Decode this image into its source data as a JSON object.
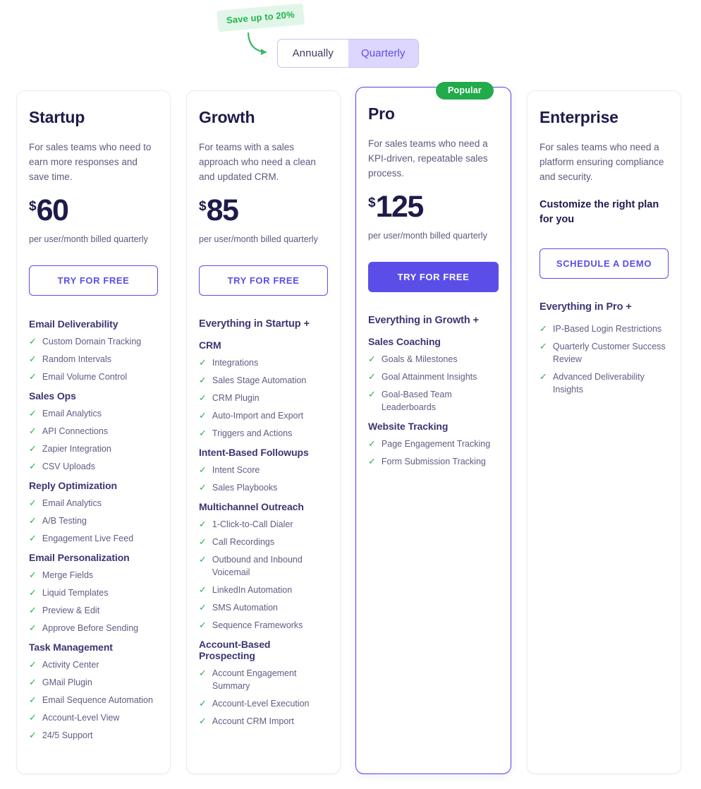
{
  "billing": {
    "save_badge": "Save up to 20%",
    "options": [
      {
        "label": "Annually",
        "active": false
      },
      {
        "label": "Quarterly",
        "active": true
      }
    ]
  },
  "badges": {
    "popular": "Popular"
  },
  "colors": {
    "accent": "#5b4ee8",
    "pro_border": "#4f46e5",
    "green": "#22b24c",
    "badge_green_bg": "#e1f6e8",
    "price": "#1e1b4b",
    "toggle_active_bg": "#ddd6fe"
  },
  "plans": [
    {
      "name": "Startup",
      "desc": "For sales teams who need to earn more responses and save time.",
      "currency": "$",
      "price": "60",
      "price_sub": "per user/month billed quarterly",
      "cta": "TRY FOR FREE",
      "cta_style": "outline",
      "groups": [
        {
          "heading": "Email Deliverability",
          "items": [
            "Custom Domain Tracking",
            "Random Intervals",
            "Email Volume Control"
          ]
        },
        {
          "heading": "Sales Ops",
          "items": [
            "Email Analytics",
            "API Connections",
            "Zapier Integration",
            "CSV Uploads"
          ]
        },
        {
          "heading": "Reply Optimization",
          "items": [
            "Email Analytics",
            "A/B Testing",
            "Engagement Live Feed"
          ]
        },
        {
          "heading": "Email Personalization",
          "items": [
            "Merge Fields",
            "Liquid Templates",
            "Preview & Edit",
            "Approve Before Sending"
          ]
        },
        {
          "heading": "Task Management",
          "items": [
            "Activity Center",
            "GMail Plugin",
            "Email Sequence Automation",
            "Account-Level View",
            "24/5 Support"
          ]
        }
      ]
    },
    {
      "name": "Growth",
      "desc": "For teams with a sales approach who need a clean and updated CRM.",
      "currency": "$",
      "price": "85",
      "price_sub": "per user/month billed quarterly",
      "cta": "TRY FOR FREE",
      "cta_style": "outline",
      "inherit": "Everything in Startup +",
      "groups": [
        {
          "heading": "CRM",
          "items": [
            "Integrations",
            "Sales Stage Automation",
            "CRM Plugin",
            "Auto-Import and Export",
            "Triggers and Actions"
          ]
        },
        {
          "heading": "Intent-Based Followups",
          "items": [
            "Intent Score",
            "Sales Playbooks"
          ]
        },
        {
          "heading": "Multichannel Outreach",
          "items": [
            "1-Click-to-Call Dialer",
            "Call Recordings",
            "Outbound and Inbound Voicemail",
            "LinkedIn Automation",
            "SMS Automation",
            "Sequence Frameworks"
          ]
        },
        {
          "heading": "Account-Based Prospecting",
          "items": [
            "Account Engagement Summary",
            "Account-Level Execution",
            "Account CRM Import"
          ]
        }
      ]
    },
    {
      "name": "Pro",
      "desc": "For sales teams who need a KPI-driven, repeatable sales process.",
      "currency": "$",
      "price": "125",
      "price_sub": "per user/month billed quarterly",
      "cta": "TRY FOR FREE",
      "cta_style": "filled",
      "inherit": "Everything in Growth +",
      "popular": true,
      "groups": [
        {
          "heading": "Sales Coaching",
          "items": [
            "Goals & Milestones",
            "Goal Attainment Insights",
            "Goal-Based Team Leaderboards"
          ]
        },
        {
          "heading": "Website Tracking",
          "items": [
            "Page Engagement Tracking",
            "Form Submission Tracking"
          ]
        }
      ]
    },
    {
      "name": "Enterprise",
      "desc": "For sales teams who need a platform ensuring compliance and security.",
      "custom_note": "Customize the right plan for you",
      "cta": "SCHEDULE A DEMO",
      "cta_style": "outline",
      "inherit": "Everything in Pro +",
      "groups": [
        {
          "heading": "",
          "items": [
            "IP-Based Login Restrictions",
            "Quarterly Customer Success Review",
            "Advanced Deliverability Insights"
          ]
        }
      ]
    }
  ],
  "icons": {
    "tick": "✓"
  }
}
